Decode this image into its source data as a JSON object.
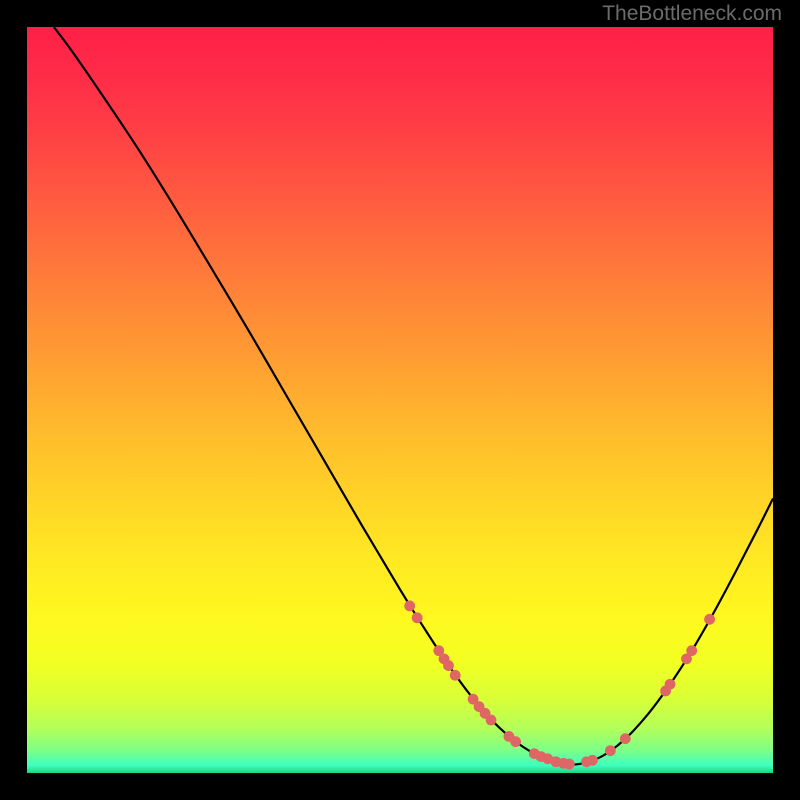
{
  "attribution": "TheBottleneck.com",
  "chart_data": {
    "type": "line",
    "title": "",
    "xlabel": "",
    "ylabel": "",
    "xlim": [
      0,
      100
    ],
    "ylim": [
      0,
      100
    ],
    "curve": [
      {
        "x": 3.6,
        "y": 100
      },
      {
        "x": 6,
        "y": 96.8
      },
      {
        "x": 10,
        "y": 91.0
      },
      {
        "x": 15,
        "y": 83.5
      },
      {
        "x": 20,
        "y": 75.5
      },
      {
        "x": 25,
        "y": 67.2
      },
      {
        "x": 30,
        "y": 58.8
      },
      {
        "x": 35,
        "y": 50.2
      },
      {
        "x": 40,
        "y": 41.6
      },
      {
        "x": 45,
        "y": 33.0
      },
      {
        "x": 50,
        "y": 24.6
      },
      {
        "x": 53,
        "y": 19.8
      },
      {
        "x": 56,
        "y": 15.2
      },
      {
        "x": 59,
        "y": 11.0
      },
      {
        "x": 62,
        "y": 7.4
      },
      {
        "x": 65,
        "y": 4.6
      },
      {
        "x": 68,
        "y": 2.6
      },
      {
        "x": 71,
        "y": 1.4
      },
      {
        "x": 74,
        "y": 1.2
      },
      {
        "x": 77,
        "y": 2.2
      },
      {
        "x": 80,
        "y": 4.4
      },
      {
        "x": 83,
        "y": 7.6
      },
      {
        "x": 86,
        "y": 11.6
      },
      {
        "x": 89,
        "y": 16.2
      },
      {
        "x": 92,
        "y": 21.4
      },
      {
        "x": 95,
        "y": 27.0
      },
      {
        "x": 98,
        "y": 32.8
      },
      {
        "x": 100,
        "y": 36.8
      }
    ],
    "markers": [
      {
        "x": 51.3,
        "y": 22.4
      },
      {
        "x": 52.3,
        "y": 20.8
      },
      {
        "x": 55.2,
        "y": 16.4
      },
      {
        "x": 55.9,
        "y": 15.3
      },
      {
        "x": 56.5,
        "y": 14.4
      },
      {
        "x": 57.4,
        "y": 13.1
      },
      {
        "x": 59.8,
        "y": 9.9
      },
      {
        "x": 60.6,
        "y": 8.9
      },
      {
        "x": 61.4,
        "y": 8.0
      },
      {
        "x": 62.2,
        "y": 7.1
      },
      {
        "x": 64.6,
        "y": 4.9
      },
      {
        "x": 65.5,
        "y": 4.2
      },
      {
        "x": 68.0,
        "y": 2.6
      },
      {
        "x": 68.9,
        "y": 2.2
      },
      {
        "x": 69.8,
        "y": 1.9
      },
      {
        "x": 70.9,
        "y": 1.5
      },
      {
        "x": 71.9,
        "y": 1.3
      },
      {
        "x": 72.7,
        "y": 1.2
      },
      {
        "x": 75.0,
        "y": 1.5
      },
      {
        "x": 75.8,
        "y": 1.7
      },
      {
        "x": 78.2,
        "y": 3.0
      },
      {
        "x": 80.2,
        "y": 4.6
      },
      {
        "x": 85.6,
        "y": 11.0
      },
      {
        "x": 86.2,
        "y": 11.9
      },
      {
        "x": 88.4,
        "y": 15.3
      },
      {
        "x": 89.1,
        "y": 16.4
      },
      {
        "x": 91.5,
        "y": 20.6
      }
    ],
    "marker_color": "#e06666",
    "curve_color": "#000000"
  }
}
